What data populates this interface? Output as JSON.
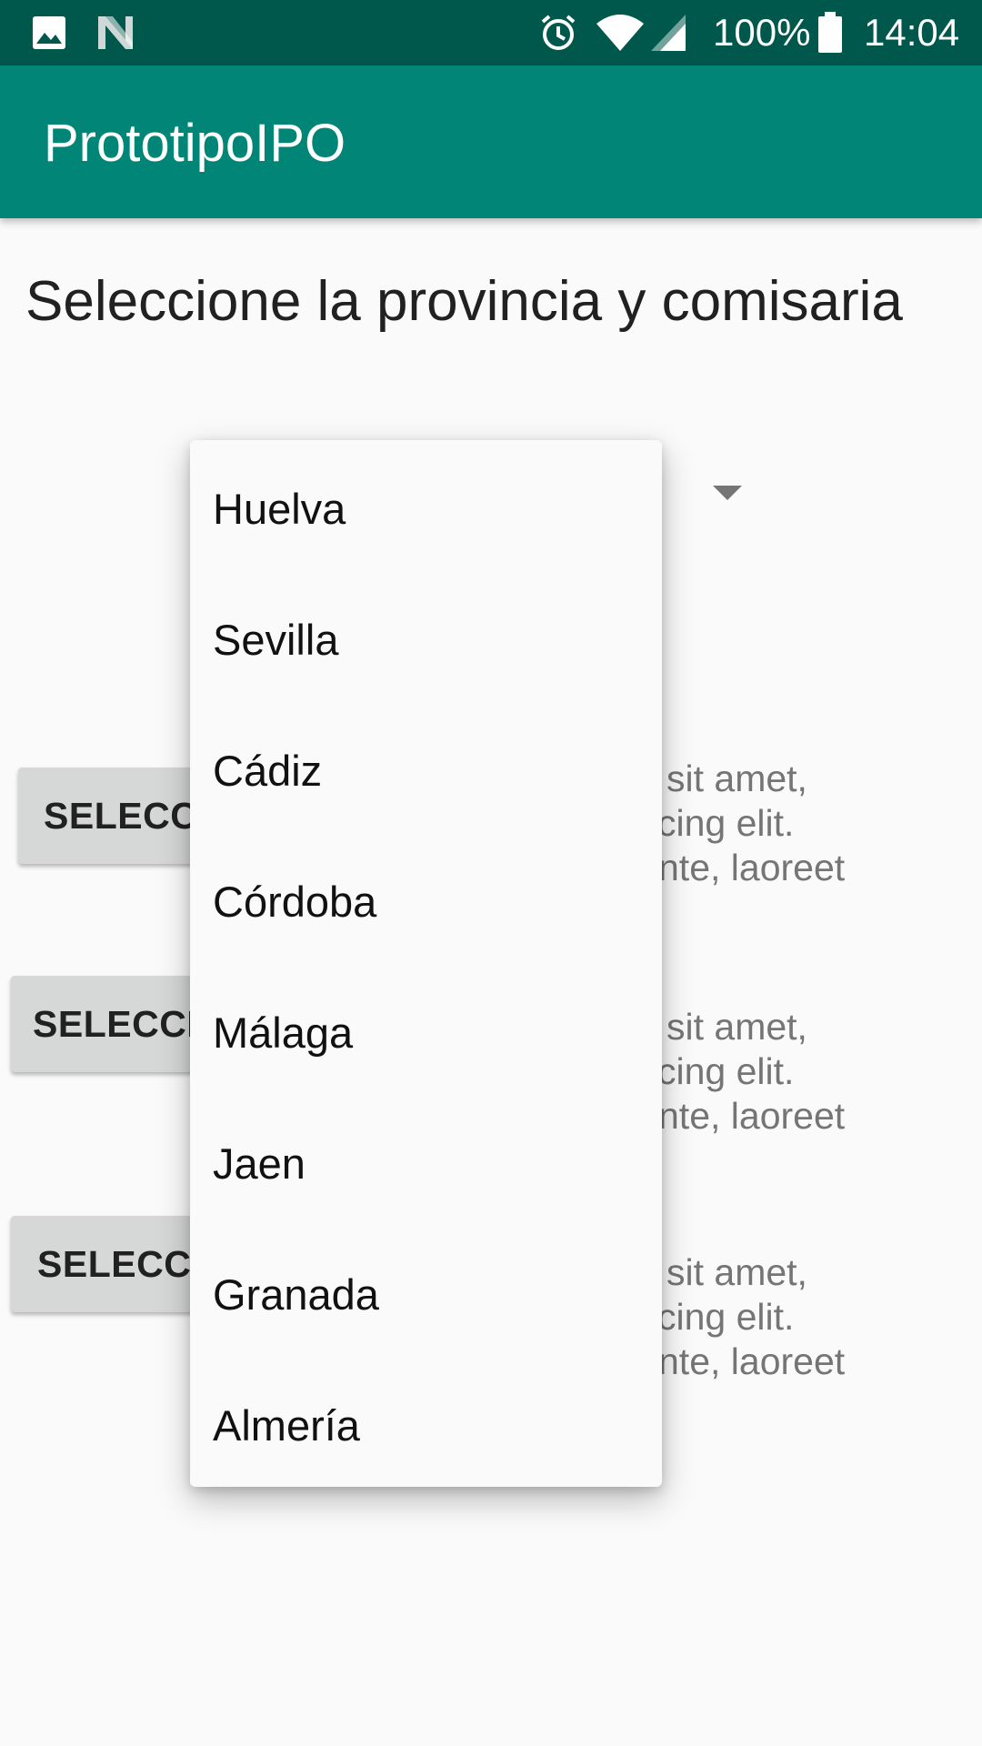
{
  "status_bar": {
    "battery": "100%",
    "time": "14:04",
    "icons": [
      "image-icon",
      "n-notification-icon",
      "alarm-icon",
      "wifi-icon",
      "cell-signal-icon",
      "battery-icon"
    ]
  },
  "app_bar": {
    "title": "PrototipoIPO"
  },
  "main": {
    "heading": "Seleccione la provincia y comisaria",
    "buttons": [
      {
        "label": "SELECCI"
      },
      {
        "label": "SELECCIO"
      },
      {
        "label": "SELECCIO"
      }
    ],
    "texts": [
      {
        "lines": [
          "sit amet,",
          "cing elit.",
          "nte, laoreet"
        ]
      },
      {
        "lines": [
          "sit amet,",
          "cing elit.",
          "nte, laoreet"
        ]
      },
      {
        "lines": [
          "sit amet,",
          "cing elit.",
          "nte, laoreet"
        ]
      }
    ]
  },
  "dropdown": {
    "items": [
      {
        "label": "Huelva"
      },
      {
        "label": "Sevilla"
      },
      {
        "label": "Cádiz"
      },
      {
        "label": "Córdoba"
      },
      {
        "label": "Málaga"
      },
      {
        "label": "Jaen"
      },
      {
        "label": "Granada"
      },
      {
        "label": "Almería"
      }
    ]
  },
  "colors": {
    "status_bar": "#00574b",
    "app_bar": "#008577",
    "background": "#fafafa",
    "button": "#d6d7d7",
    "secondary_text": "#757575"
  }
}
